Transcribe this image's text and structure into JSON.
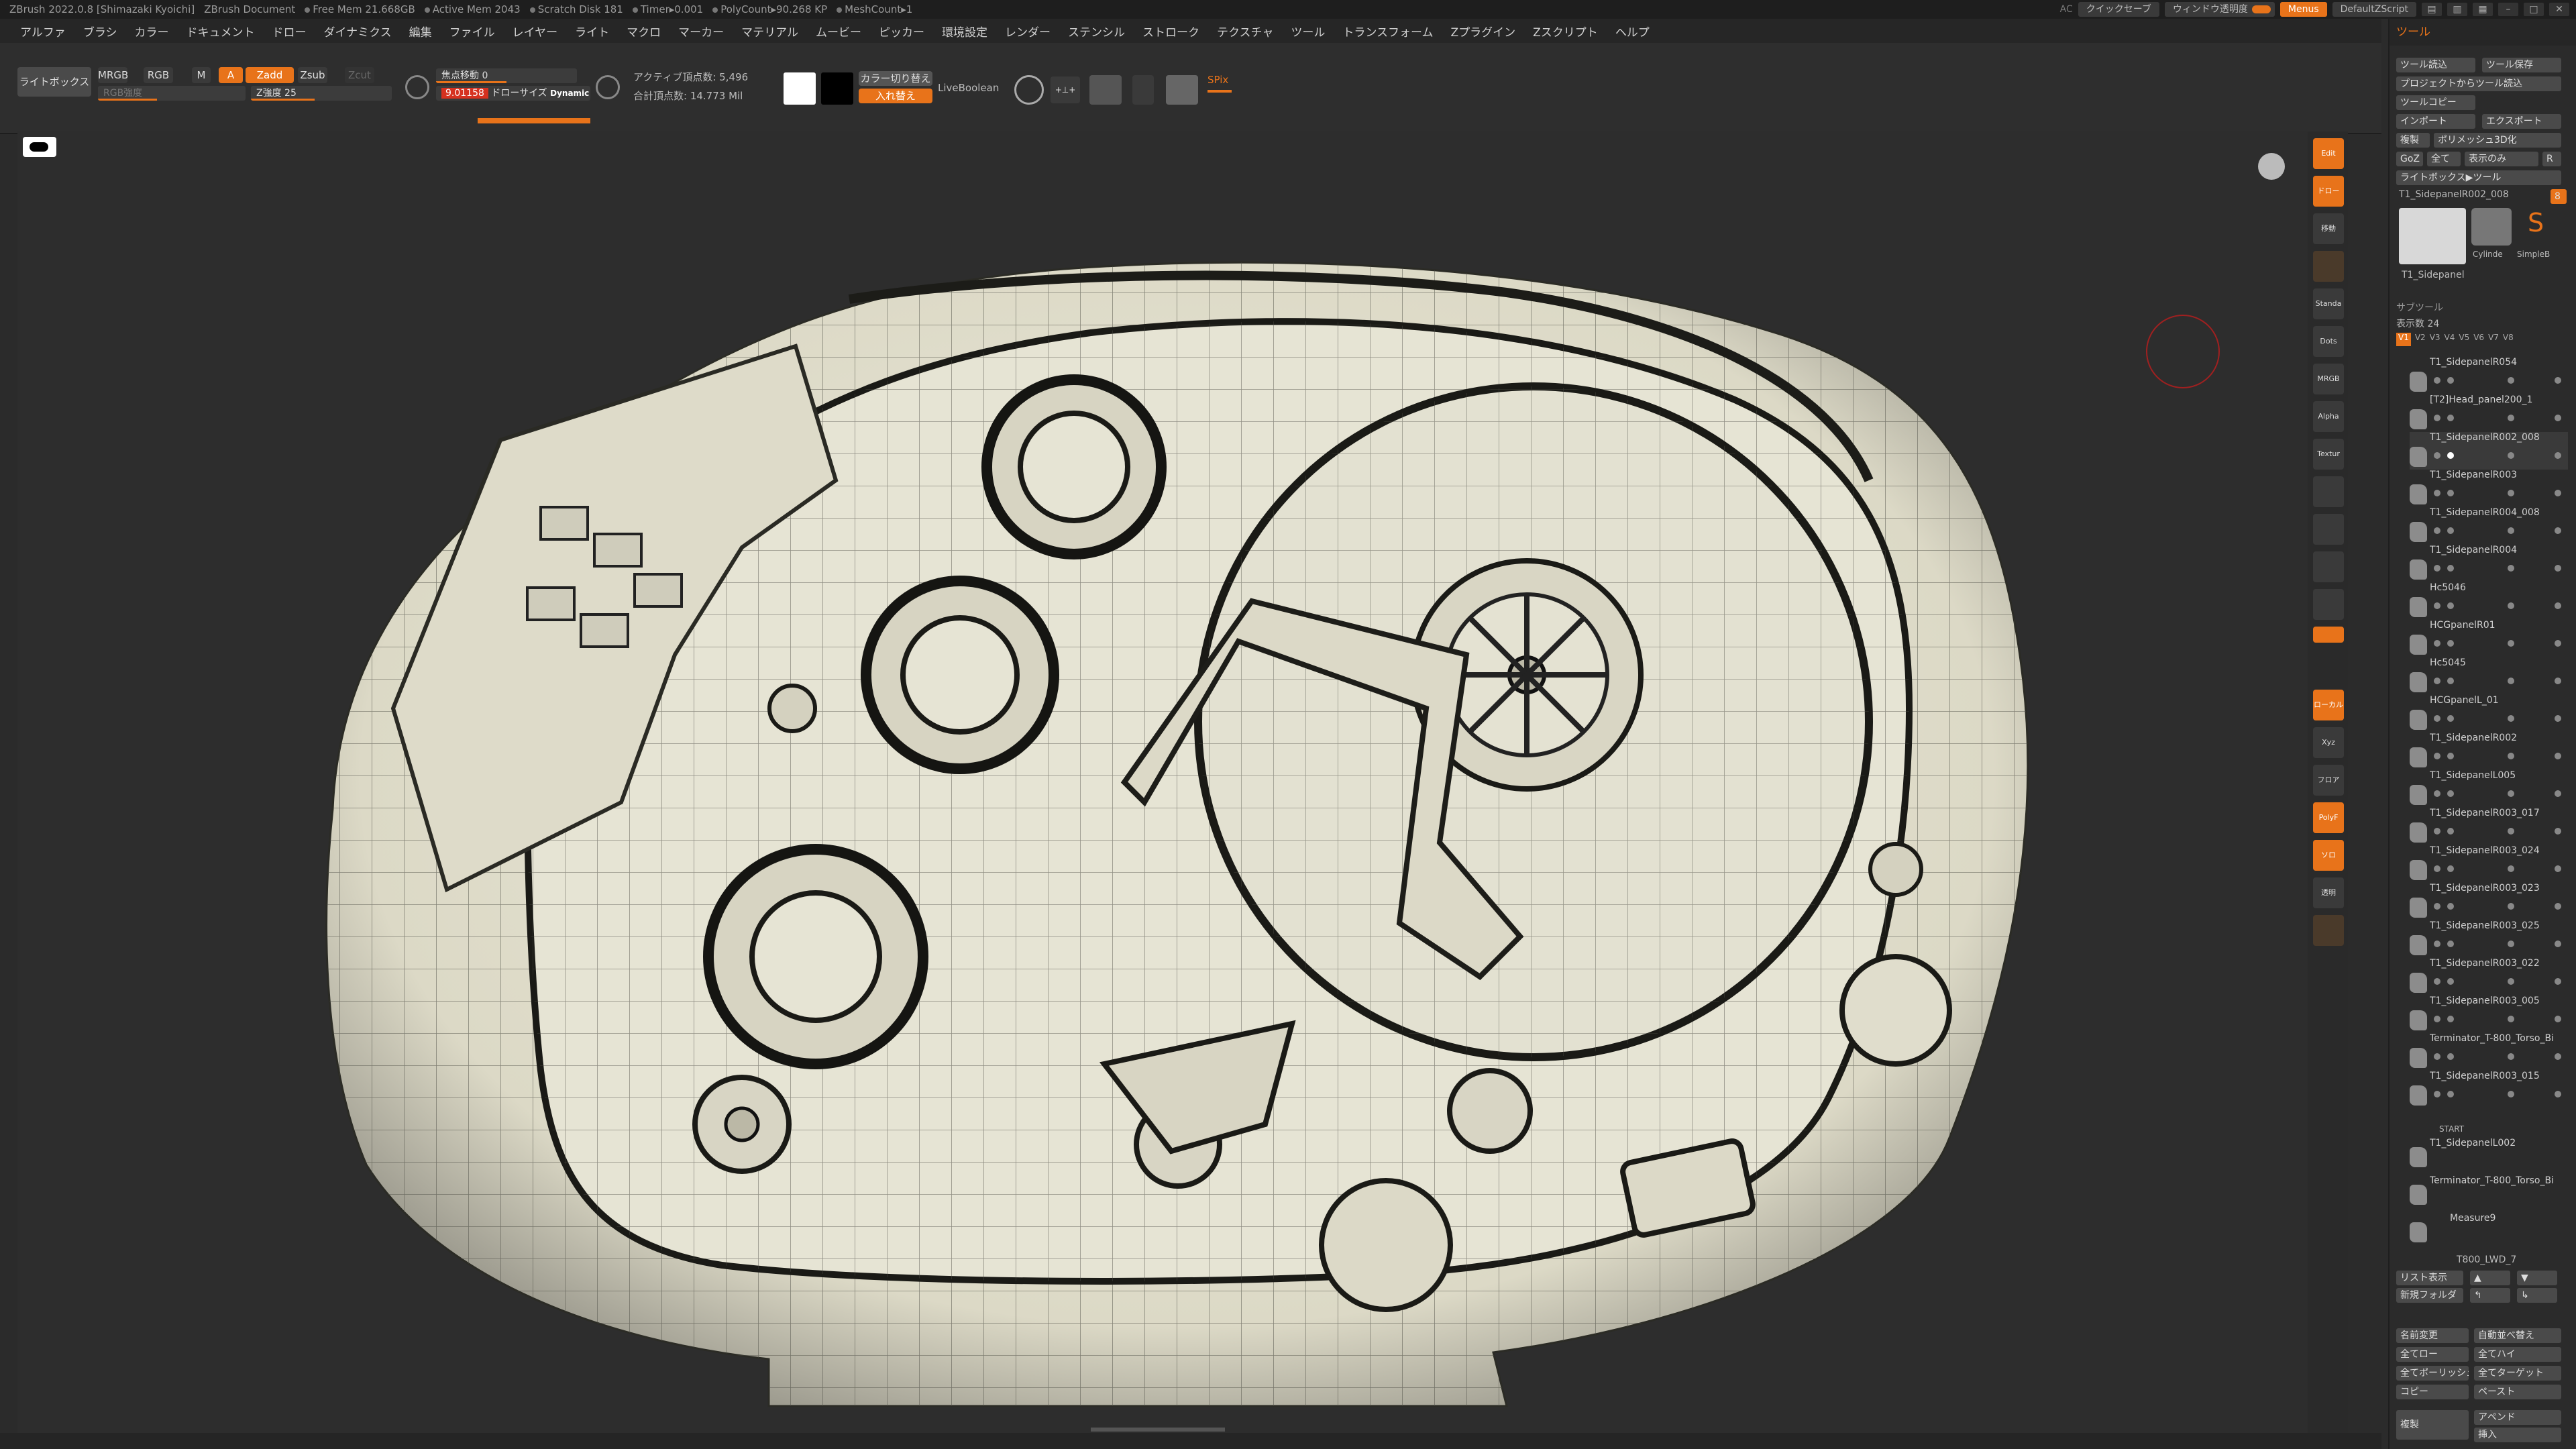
{
  "titlebar": {
    "app": "ZBrush 2022.0.8 [Shimazaki Kyoichi]",
    "doc": "ZBrush Document",
    "free_mem": "Free Mem 21.668GB",
    "active_mem": "Active Mem 2043",
    "scratch": "Scratch Disk 181",
    "timer": "Timer▸0.001",
    "polycount": "PolyCount▸90.268 KP",
    "meshcount": "MeshCount▸1",
    "ac": "AC",
    "quicksave": "クイックセーブ",
    "win_opacity": "ウィンドウ透明度",
    "menus": "Menus",
    "default_script": "DefaultZScript"
  },
  "menubar": {
    "items": [
      "アルファ",
      "ブラシ",
      "カラー",
      "ドキュメント",
      "ドロー",
      "ダイナミクス",
      "編集",
      "ファイル",
      "レイヤー",
      "ライト",
      "マクロ",
      "マーカー",
      "マテリアル",
      "ムービー",
      "ピッカー",
      "環境設定",
      "レンダー",
      "ステンシル",
      "ストローク",
      "テクスチャ",
      "ツール",
      "トランスフォーム",
      "Zプラグイン",
      "Zスクリプト",
      "ヘルプ"
    ]
  },
  "shelf": {
    "lightbox": "ライトボックス",
    "mrgb": "MRGB",
    "rgb": "RGB",
    "m": "M",
    "a": "A",
    "zadd": "Zadd",
    "zsub": "Zsub",
    "zcut": "Zcut",
    "rgb_intensity": "RGB強度",
    "z_intensity": "Z強度 25",
    "focal_shift": "焦点移動 0",
    "draw_size_value": "9.01158",
    "draw_size": "ドローサイズ",
    "dynamic": "Dynamic",
    "active_points": "アクティブ頂点数: 5,496",
    "total_points": "合計頂点数: 14.773 Mil",
    "color_switch": "カラー切り替え",
    "swap": "入れ替え",
    "liveboolean": "LiveBoolean",
    "spix": "SPix"
  },
  "vtools": {
    "edit": "Edit",
    "draw": "ドロー",
    "move": "移動",
    "standard": "Standa",
    "dots": "Dots",
    "mrgb": "MRGB",
    "alpha": "Alpha",
    "texture": "Textur",
    "local": "ローカル",
    "xyz": "Xyz",
    "grid": "フロア",
    "poly": "PolyF",
    "solo": "ソロ",
    "transp": "透明"
  },
  "rpanel": {
    "header": "ツール",
    "load_tool": "ツール読込",
    "save_tool": "ツール保存",
    "load_from_project": "プロジェクトからツール読込",
    "copy_tool": "ツールコピー",
    "import": "インポート",
    "export": "エクスポート",
    "clone": "複製",
    "polymesh3d": "ポリメッシュ3D化",
    "goz": "GoZ",
    "all": "全て",
    "visible": "表示のみ",
    "r": "R",
    "lightbox_tool": "ライトボックス▶ツール",
    "current_tool": "T1_SidepanelR002_008",
    "current_tool_value": "8",
    "cylinder": "Cylinde",
    "simple": "SimpleB",
    "thumb_label": "T1_Sidepanel",
    "subtool_header": "サブツール",
    "display_count": "表示数 24",
    "versions": [
      "V1",
      "V2",
      "V3",
      "V4",
      "V5",
      "V6",
      "V7",
      "V8"
    ],
    "subtools": [
      "T1_SidepanelR054",
      "[T2]Head_panel200_1",
      "T1_SidepanelR002_008",
      "T1_SidepanelR003",
      "T1_SidepanelR004_008",
      "T1_SidepanelR004",
      "Hc5046",
      "HCGpanelR01",
      "Hc5045",
      "HCGpanelL_01",
      "T1_SidepanelR002",
      "T1_SidepanelL005",
      "T1_SidepanelR003_017",
      "T1_SidepanelR003_024",
      "T1_SidepanelR003_023",
      "T1_SidepanelR003_025",
      "T1_SidepanelR003_022",
      "T1_SidepanelR003_005",
      "Terminator_T-800_Torso_Bi",
      "T1_SidepanelR003_015",
      "T1_SidepanelL002",
      "Terminator_T-800_Torso_Bi",
      "Measure9",
      "T800_LWD_7"
    ],
    "start": "START",
    "list_view": "リスト表示",
    "new_folder": "新規フォルダ",
    "rename": "名前変更",
    "auto_reorder": "自動並べ替え",
    "all_low": "全てロー",
    "all_high": "全てハイ",
    "all_to_polish": "全てポーリッシュへ",
    "all_target": "全てターゲット",
    "copy": "コピー",
    "paste": "ペースト",
    "duplicate": "複製",
    "append": "アペンド",
    "insert": "挿入"
  },
  "colors": {
    "accent": "#e8731a",
    "model": "#e8e6d6",
    "background": "#2d2d2d",
    "wire": "#3a3a32"
  },
  "icons": [
    "close-icon",
    "minimize-icon",
    "maximize-icon",
    "brush-icon",
    "cursor-circle-icon",
    "head-navigator-icon"
  ]
}
